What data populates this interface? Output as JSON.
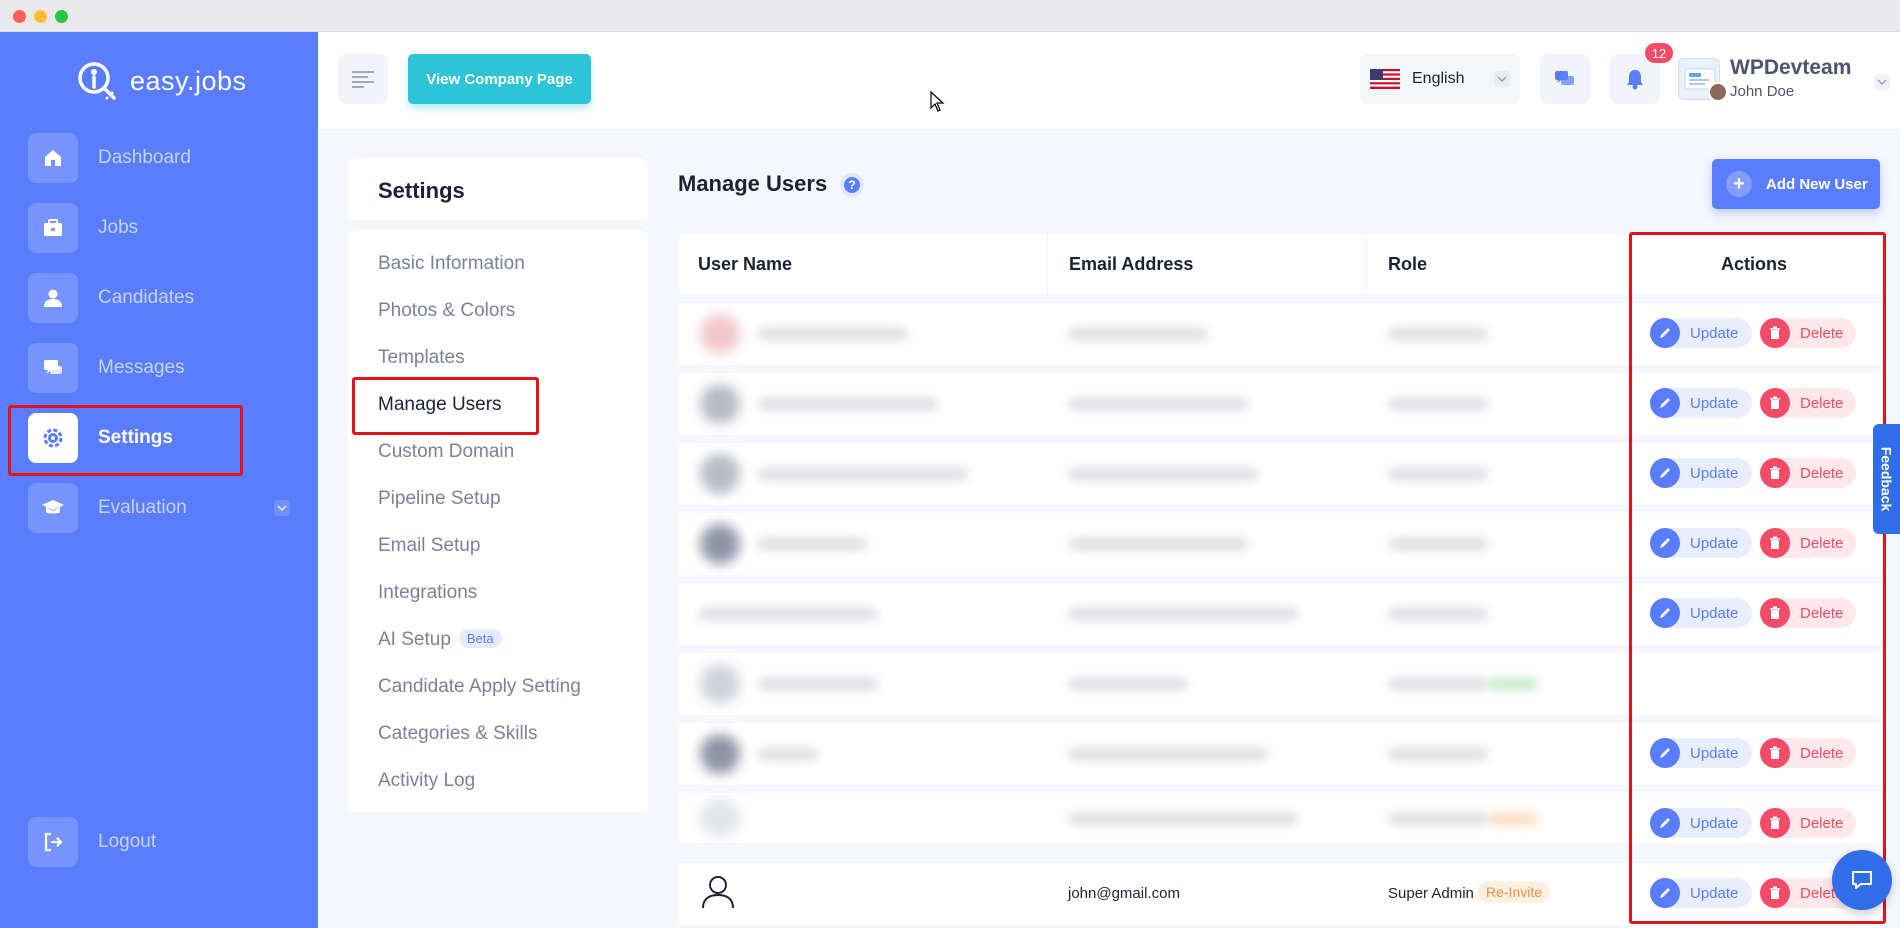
{
  "brand": {
    "name": "easy.jobs"
  },
  "sidebar": {
    "items": [
      {
        "label": "Dashboard",
        "icon": "home-icon"
      },
      {
        "label": "Jobs",
        "icon": "briefcase-icon"
      },
      {
        "label": "Candidates",
        "icon": "user-icon"
      },
      {
        "label": "Messages",
        "icon": "chat-icon"
      },
      {
        "label": "Settings",
        "icon": "gear-icon",
        "active": true
      },
      {
        "label": "Evaluation",
        "icon": "graduation-cap-icon"
      }
    ],
    "logout": "Logout"
  },
  "topbar": {
    "view_company": "View Company Page",
    "language": "English",
    "notification_count": "12",
    "company": "WPDevteam",
    "user": "John Doe"
  },
  "settings": {
    "title": "Settings",
    "links": [
      "Basic Information",
      "Photos & Colors",
      "Templates",
      "Manage Users",
      "Custom Domain",
      "Pipeline Setup",
      "Email Setup",
      "Integrations",
      "AI Setup",
      "Candidate Apply Setting",
      "Categories & Skills",
      "Activity Log"
    ],
    "beta_badge": "Beta",
    "active": "Manage Users"
  },
  "main": {
    "title": "Manage Users",
    "help": "?",
    "add_user": "Add New User",
    "table": {
      "headers": [
        "User Name",
        "Email Address",
        "Role",
        "Actions"
      ],
      "actions": {
        "update": "Update",
        "delete": "Delete"
      },
      "last_row": {
        "email": "john@gmail.com",
        "role": "Super Admin",
        "reinvite": "Re-Invite"
      }
    }
  },
  "feedback": "Feedback",
  "colors": {
    "sidebar": "#597dfc",
    "accent": "#597dfc",
    "danger": "#f44b66",
    "cyan": "#2ec4d8",
    "highlight": "#e5121a"
  }
}
